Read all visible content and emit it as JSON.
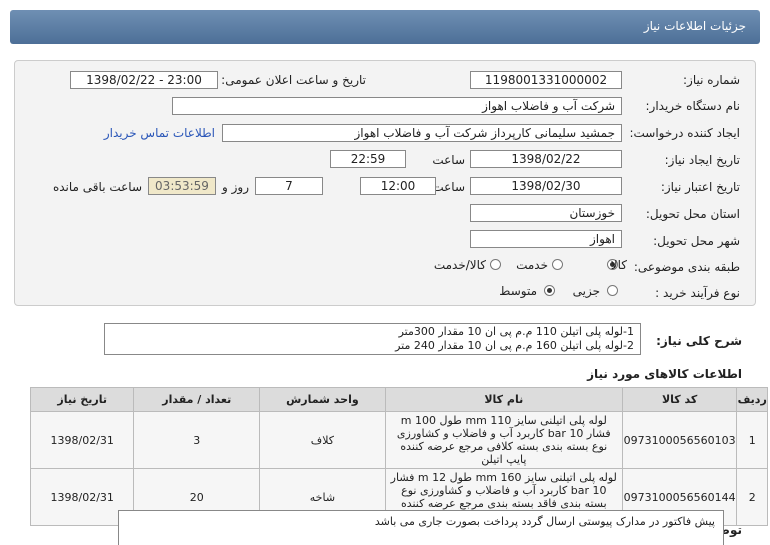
{
  "header": {
    "title": "جزئیات اطلاعات نیاز"
  },
  "form": {
    "need_number": {
      "label": "شماره نیاز:",
      "value": "1198001331000002"
    },
    "announce": {
      "label": "تاریخ و ساعت اعلان عمومی:",
      "value": "1398/02/22 - 23:00"
    },
    "buyer_org": {
      "label": "نام دستگاه خریدار:",
      "value": "شرکت آب و فاضلاب اهواز"
    },
    "requester": {
      "label": "ایجاد کننده درخواست:",
      "value": "جمشید سلیمانی کارپرداز شرکت آب و فاضلاب اهواز",
      "contact_link": "اطلاعات تماس خریدار"
    },
    "created": {
      "label": "تاریخ ایجاد نیاز:",
      "date": "1398/02/22",
      "time_label": "ساعت",
      "time": "22:59"
    },
    "validity": {
      "label": "تاریخ اعتبار نیاز:",
      "date": "1398/02/30",
      "time_label": "ساعت",
      "time": "12:00",
      "days": "7",
      "days_label": "روز و",
      "remaining": "03:53:59",
      "remaining_label": "ساعت باقی مانده"
    },
    "province": {
      "label": "استان محل تحویل:",
      "value": "خوزستان"
    },
    "city": {
      "label": "شهر محل تحویل:",
      "value": "اهواز"
    },
    "category": {
      "label": "طبقه بندی موضوعی:",
      "options": [
        "کالا",
        "خدمت",
        "کالا/خدمت"
      ],
      "selected": "کالا"
    },
    "process": {
      "label": "نوع فرآیند خرید :",
      "options": [
        "جزیی",
        "متوسط"
      ],
      "selected": "متوسط"
    }
  },
  "summary": {
    "label": "شرح کلی نیاز:",
    "lines": [
      "1-لوله پلی اتیلن 110 م.م پی ان 10 مقدار 300متر",
      "2-لوله پلی اتیلن 160 م.م پی ان 10 مقدار 240 متر"
    ]
  },
  "goods": {
    "title": "اطلاعات کالاهای مورد نیاز",
    "columns": [
      "ردیف",
      "کد کالا",
      "نام کالا",
      "واحد شمارش",
      "تعداد / مقدار",
      "تاریخ نیاز"
    ],
    "rows": [
      {
        "row": "1",
        "code": "0973100056560103",
        "name": "لوله پلی اتیلنی سایز 110 mm طول 100 m فشار 10 bar کاربرد آب و فاضلاب و کشاورزی نوع بسته بندی بسته کلافی مرجع عرضه کننده پایپ اتیلن",
        "unit": "کلاف",
        "qty": "3",
        "date": "1398/02/31"
      },
      {
        "row": "2",
        "code": "0973100056560144",
        "name": "لوله پلی اتیلنی سایز 160 mm طول 12 m فشار 10 bar کاربرد آب و فاضلاب و کشاورزی نوع بسته بندی فاقد بسته بندی مرجع عرضه کننده پایپ اتیلن",
        "unit": "شاخه",
        "qty": "20",
        "date": "1398/02/31"
      }
    ]
  },
  "buyer_notes": {
    "label": "توضیحات خریدار:",
    "text": "پیش فاکتور در مدارک پیوستی ارسال گردد پرداخت بصورت جاری می باشد"
  }
}
